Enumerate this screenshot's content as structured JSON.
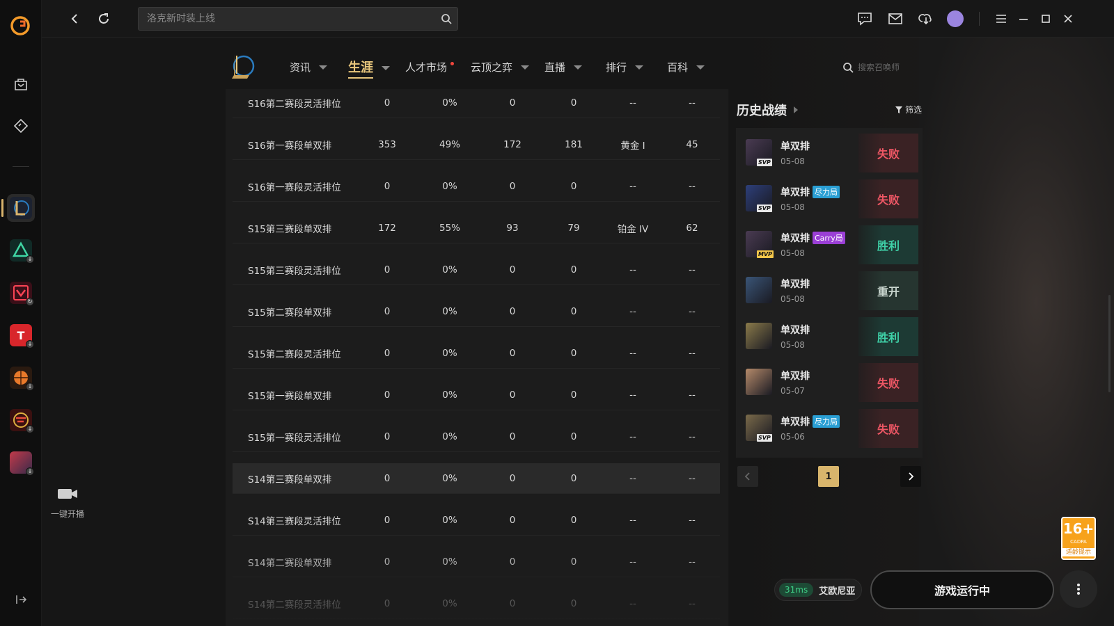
{
  "search": {
    "placeholder": "洛克新时装上线"
  },
  "sidebar": {
    "cast_label": "一键开播"
  },
  "nav": {
    "items": [
      {
        "label": "资讯"
      },
      {
        "label": "生涯"
      },
      {
        "label": "人才市场"
      },
      {
        "label": "云顶之弈"
      },
      {
        "label": "直播"
      },
      {
        "label": "排行"
      },
      {
        "label": "百科"
      }
    ],
    "summoner_placeholder": "搜索召唤师"
  },
  "seasons": [
    [
      "S16第二赛段灵活排位",
      "0",
      "0%",
      "0",
      "0",
      "--",
      "--"
    ],
    [
      "S16第一赛段单双排",
      "353",
      "49%",
      "172",
      "181",
      "黄金 I",
      "45"
    ],
    [
      "S16第一赛段灵活排位",
      "0",
      "0%",
      "0",
      "0",
      "--",
      "--"
    ],
    [
      "S15第三赛段单双排",
      "172",
      "55%",
      "93",
      "79",
      "铂金 IV",
      "62"
    ],
    [
      "S15第三赛段灵活排位",
      "0",
      "0%",
      "0",
      "0",
      "--",
      "--"
    ],
    [
      "S15第二赛段单双排",
      "0",
      "0%",
      "0",
      "0",
      "--",
      "--"
    ],
    [
      "S15第二赛段灵活排位",
      "0",
      "0%",
      "0",
      "0",
      "--",
      "--"
    ],
    [
      "S15第一赛段单双排",
      "0",
      "0%",
      "0",
      "0",
      "--",
      "--"
    ],
    [
      "S15第一赛段灵活排位",
      "0",
      "0%",
      "0",
      "0",
      "--",
      "--"
    ],
    [
      "S14第三赛段单双排",
      "0",
      "0%",
      "0",
      "0",
      "--",
      "--"
    ],
    [
      "S14第三赛段灵活排位",
      "0",
      "0%",
      "0",
      "0",
      "--",
      "--"
    ],
    [
      "S14第二赛段单双排",
      "0",
      "0%",
      "0",
      "0",
      "--",
      "--"
    ],
    [
      "S14第二赛段灵活排位",
      "0",
      "0%",
      "0",
      "0",
      "--",
      "--"
    ]
  ],
  "history": {
    "title": "历史战绩",
    "filter_label": "筛选",
    "matches": [
      {
        "mode": "单双排",
        "tag": "",
        "badge": "SVP",
        "date": "05-08",
        "result": "失败",
        "kind": "lose",
        "color": "#4a3b52"
      },
      {
        "mode": "单双排",
        "tag": "尽力局",
        "badge": "SVP",
        "date": "05-08",
        "result": "失败",
        "kind": "lose",
        "color": "#2d3f7a"
      },
      {
        "mode": "单双排",
        "tag": "Carry局",
        "badge": "MVP",
        "date": "05-08",
        "result": "胜利",
        "kind": "win",
        "color": "#4a3b52"
      },
      {
        "mode": "单双排",
        "tag": "",
        "badge": "",
        "date": "05-08",
        "result": "重开",
        "kind": "redo",
        "color": "#3a5577"
      },
      {
        "mode": "单双排",
        "tag": "",
        "badge": "",
        "date": "05-08",
        "result": "胜利",
        "kind": "win",
        "color": "#8a7a4a"
      },
      {
        "mode": "单双排",
        "tag": "",
        "badge": "",
        "date": "05-07",
        "result": "失败",
        "kind": "lose",
        "color": "#b58a6a"
      },
      {
        "mode": "单双排",
        "tag": "尽力局",
        "badge": "SVP",
        "date": "05-06",
        "result": "失败",
        "kind": "lose",
        "color": "#7a6a4a"
      }
    ],
    "page": "1"
  },
  "age": {
    "num": "16+",
    "sub": "CADPA",
    "label": "适龄提示"
  },
  "status": {
    "ping": "31ms",
    "server": "艾欧尼亚",
    "launch_label": "游戏运行中"
  },
  "colors": {
    "accent": "#d8b56c",
    "win": "#3fd1a8",
    "lose": "#ef5765"
  }
}
